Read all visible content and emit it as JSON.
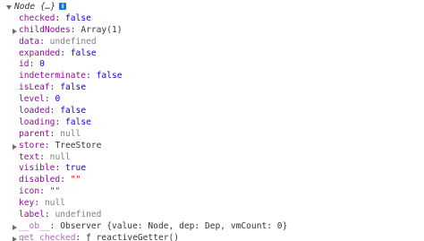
{
  "root": {
    "label": "Node {…}",
    "info_icon": "i"
  },
  "properties": [
    {
      "key": "checked",
      "value": "false",
      "type": "bool",
      "expandable": false
    },
    {
      "key": "childNodes",
      "value": "Array(1)",
      "type": "obj",
      "expandable": true
    },
    {
      "key": "data",
      "value": "undefined",
      "type": "nul",
      "expandable": false
    },
    {
      "key": "expanded",
      "value": "false",
      "type": "bool",
      "expandable": false
    },
    {
      "key": "id",
      "value": "0",
      "type": "num",
      "expandable": false
    },
    {
      "key": "indeterminate",
      "value": "false",
      "type": "bool",
      "expandable": false
    },
    {
      "key": "isLeaf",
      "value": "false",
      "type": "bool",
      "expandable": false
    },
    {
      "key": "level",
      "value": "0",
      "type": "num",
      "expandable": false
    },
    {
      "key": "loaded",
      "value": "false",
      "type": "bool",
      "expandable": false
    },
    {
      "key": "loading",
      "value": "false",
      "type": "bool",
      "expandable": false
    },
    {
      "key": "parent",
      "value": "null",
      "type": "nul",
      "expandable": false
    },
    {
      "key": "store",
      "value": "TreeStore",
      "type": "obj",
      "expandable": true
    },
    {
      "key": "text",
      "value": "null",
      "type": "nul",
      "expandable": false
    },
    {
      "key": "visible",
      "value": "true",
      "type": "bool",
      "expandable": false
    },
    {
      "key": "disabled",
      "value": "\"\"",
      "type": "str",
      "expandable": false
    },
    {
      "key": "icon",
      "value": "\"\"",
      "type": "str",
      "expandable": false
    },
    {
      "key": "key",
      "value": "null",
      "type": "nul",
      "expandable": false
    },
    {
      "key": "label",
      "value": "undefined",
      "type": "nul",
      "expandable": false
    },
    {
      "key": "__ob__",
      "value": "Observer {value: Node, dep: Dep, vmCount: 0}",
      "type": "obj",
      "expandable": true,
      "dim": true
    },
    {
      "key": "get checked",
      "value": "ƒ reactiveGetter()",
      "type": "obj",
      "expandable": true,
      "dim": true,
      "cut": true
    }
  ]
}
